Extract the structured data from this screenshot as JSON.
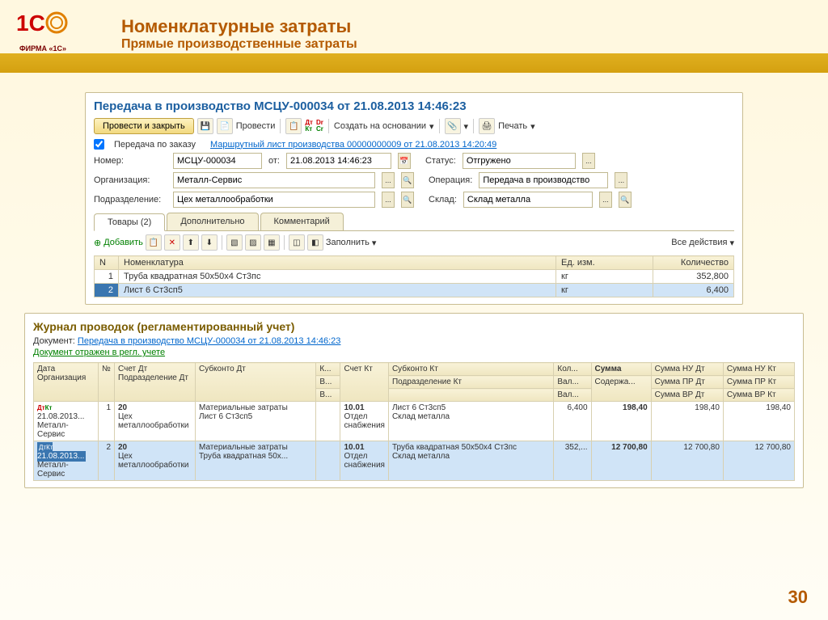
{
  "header": {
    "title": "Номенклатурные затраты",
    "subtitle": "Прямые производственные затраты",
    "logo_caption": "ФИРМА «1С»"
  },
  "doc": {
    "title": "Передача в производство МСЦУ-000034 от 21.08.2013 14:46:23",
    "btn_provesti": "Провести и закрыть",
    "btn_provesti2": "Провести",
    "btn_sozdat": "Создать на основании",
    "btn_pechat": "Печать",
    "chk_peredacha": "Передача по заказу",
    "route_link": "Маршрутный лист производства 00000000009 от 21.08.2013 14:20:49",
    "lbl_nomer": "Номер:",
    "val_nomer": "МСЦУ-000034",
    "lbl_ot": "от:",
    "val_date": "21.08.2013 14:46:23",
    "lbl_status": "Статус:",
    "val_status": "Отгружено",
    "lbl_org": "Организация:",
    "val_org": "Металл-Сервис",
    "lbl_oper": "Операция:",
    "val_oper": "Передача в производство",
    "lbl_podr": "Подразделение:",
    "val_podr": "Цех металлообработки",
    "lbl_sklad": "Склад:",
    "val_sklad": "Склад металла",
    "tabs": [
      "Товары (2)",
      "Дополнительно",
      "Комментарий"
    ],
    "btn_add": "Добавить",
    "btn_zapolnit": "Заполнить",
    "btn_all_actions": "Все действия",
    "table_headers": {
      "n": "N",
      "nomenk": "Номенклатура",
      "ed": "Ед. изм.",
      "kol": "Количество"
    },
    "rows": [
      {
        "n": "1",
        "nomenk": "Труба квадратная 50х50х4 Ст3пс",
        "ed": "кг",
        "kol": "352,800"
      },
      {
        "n": "2",
        "nomenk": "Лист 6 Ст3сп5",
        "ed": "кг",
        "kol": "6,400"
      }
    ]
  },
  "journal": {
    "title": "Журнал проводок (регламентированный учет)",
    "lbl_doc": "Документ:",
    "doc_link": "Передача в производство МСЦУ-000034 от 21.08.2013 14:46:23",
    "status_text": "Документ отражен в регл. учете",
    "headers": {
      "c1a": "Дата",
      "c1b": "Организация",
      "c2": "№",
      "c3a": "Счет Дт",
      "c3b": "Подразделение Дт",
      "c4": "Субконто Дт",
      "c5a": "К...",
      "c5b": "В...",
      "c5c": "В...",
      "c6": "Счет Кт",
      "c7a": "Субконто Кт",
      "c7b": "Подразделение Кт",
      "c8a": "Кол...",
      "c8b": "Вал...",
      "c8c": "Вал...",
      "c9a": "Сумма",
      "c9b": "Содержа...",
      "c10a": "Сумма НУ Дт",
      "c10b": "Сумма ПР Дт",
      "c10c": "Сумма ВР Дт",
      "c11a": "Сумма НУ Кт",
      "c11b": "Сумма ПР Кт",
      "c11c": "Сумма ВР Кт"
    },
    "rows": [
      {
        "date": "21.08.2013...",
        "org": "Металл-Сервис",
        "n": "1",
        "schet_dt": "20",
        "podr_dt": "Цех металлообработки",
        "sub_dt1": "Материальные затраты",
        "sub_dt2": "Лист 6 Ст3сп5",
        "schet_kt": "10.01",
        "kt_extra": "Отдел снабжения",
        "sub_kt1": "Лист 6 Ст3сп5",
        "sub_kt2": "Склад металла",
        "kol": "6,400",
        "summa": "198,40",
        "nu_dt": "198,40",
        "nu_kt": "198,40"
      },
      {
        "date": "21.08.2013...",
        "org": "Металл-Сервис",
        "n": "2",
        "schet_dt": "20",
        "podr_dt": "Цех металлообработки",
        "sub_dt1": "Материальные затраты",
        "sub_dt2": "Труба квадратная 50х...",
        "schet_kt": "10.01",
        "kt_extra": "Отдел снабжения",
        "sub_kt1": "Труба квадратная 50х50х4 Ст3пс",
        "sub_kt2": "Склад металла",
        "kol": "352,...",
        "summa": "12 700,80",
        "nu_dt": "12 700,80",
        "nu_kt": "12 700,80"
      }
    ]
  },
  "page_num": "30"
}
